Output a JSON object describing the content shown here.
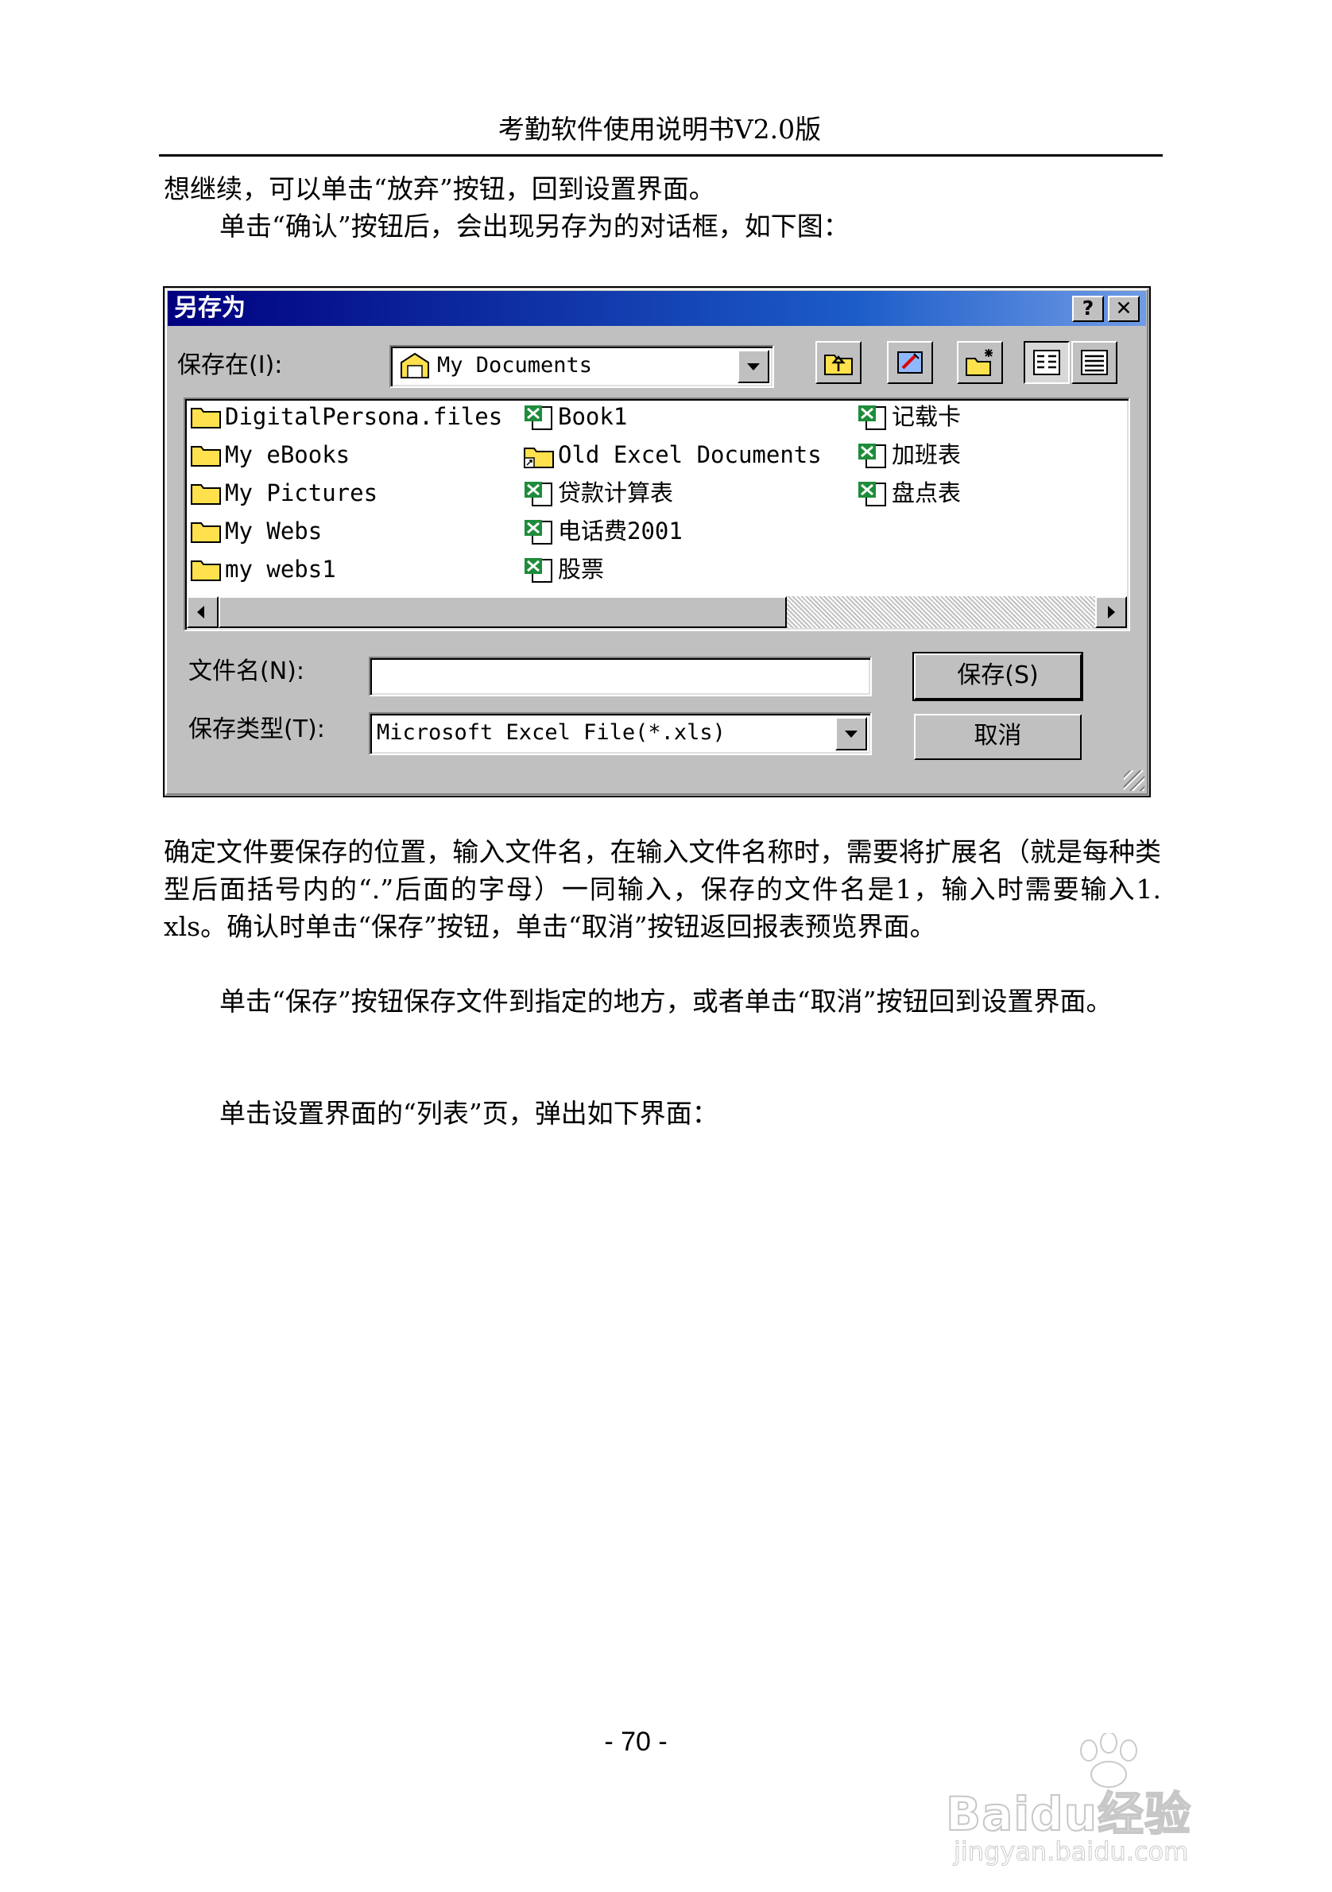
{
  "header": {
    "title": "考勤软件使用说明书V2.0版"
  },
  "paragraphs": {
    "p1": "想继续，可以单击“放弃”按钮，回到设置界面。",
    "p2": "单击“确认”按钮后，会出现另存为的对话框，如下图：",
    "p3": "确定文件要保存的位置，输入文件名，在输入文件名称时，需要将扩展名（就是每种类型后面括号内的“.”后面的字母）一同输入，保存的文件名是1，输入时需要输入1. xls。确认时单击“保存”按钮，单击“取消”按钮返回报表预览界面。",
    "p4": "单击“保存”按钮保存文件到指定的地方，或者单击“取消”按钮回到设置界面。",
    "p5": "单击设置界面的“列表”页，弹出如下界面："
  },
  "dialog": {
    "title": "另存为",
    "help_label": "?",
    "close_label": "✕",
    "save_in_label": "保存在(I):",
    "save_in_value": "My Documents",
    "toolbar_icons": [
      "up-one-level-icon",
      "desktop-icon",
      "new-folder-icon",
      "list-view-icon",
      "details-view-icon"
    ],
    "files": [
      {
        "name": "DigitalPersona.files",
        "type": "folder"
      },
      {
        "name": "My eBooks",
        "type": "folder"
      },
      {
        "name": "My Pictures",
        "type": "folder"
      },
      {
        "name": "My Webs",
        "type": "folder"
      },
      {
        "name": "my webs1",
        "type": "folder"
      },
      {
        "name": "Book1",
        "type": "excel"
      },
      {
        "name": "Old Excel Documents",
        "type": "shortcut-folder"
      },
      {
        "name": "贷款计算表",
        "type": "excel"
      },
      {
        "name": "电话费2001",
        "type": "excel"
      },
      {
        "name": "股票",
        "type": "excel"
      },
      {
        "name": "记载卡",
        "type": "excel"
      },
      {
        "name": "加班表",
        "type": "excel"
      },
      {
        "name": "盘点表",
        "type": "excel"
      }
    ],
    "filename_label": "文件名(N):",
    "filename_value": "",
    "filetype_label": "保存类型(T):",
    "filetype_value": "Microsoft Excel File(*.xls)",
    "save_button": "保存(S)",
    "cancel_button": "取消"
  },
  "footer": {
    "page_number": "- 70 -"
  },
  "watermark": {
    "logo_text": "Baidu经验",
    "site": "jingyan.baidu.com"
  },
  "colors": {
    "titlebar_start": "#00007f",
    "titlebar_end": "#6f9be6",
    "dialog_face": "#c0c0c0",
    "folder": "#ffe14d",
    "excel": "#1e8c3a"
  }
}
